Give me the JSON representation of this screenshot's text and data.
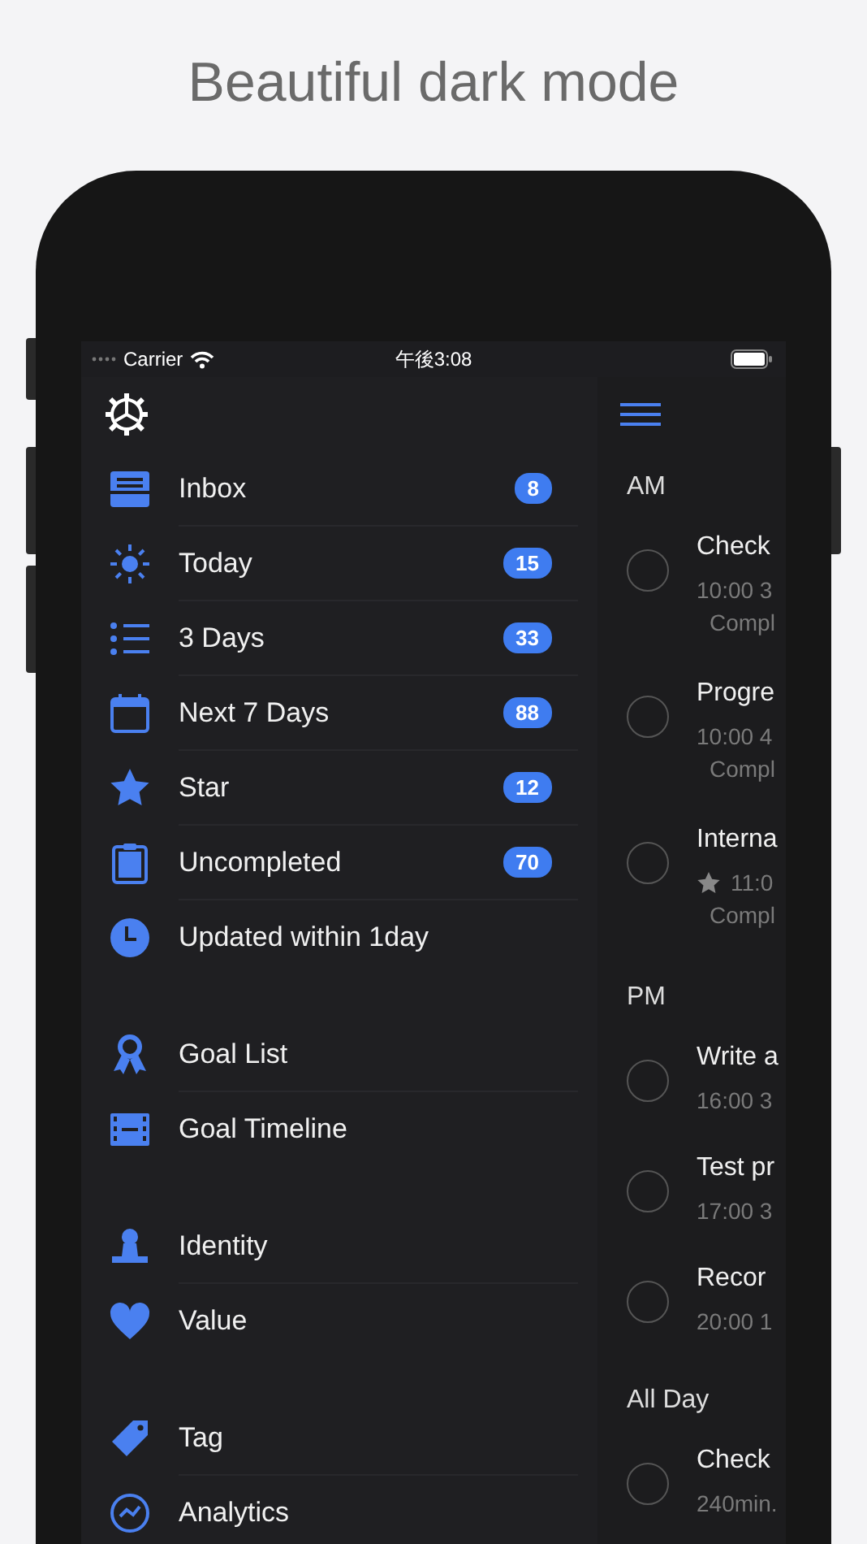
{
  "headline": "Beautiful dark mode",
  "status_bar": {
    "carrier": "Carrier",
    "time": "午後3:08"
  },
  "sidebar": {
    "sections": [
      {
        "items": [
          {
            "label": "Inbox",
            "count": "8"
          },
          {
            "label": "Today",
            "count": "15"
          },
          {
            "label": "3 Days",
            "count": "33"
          },
          {
            "label": "Next 7 Days",
            "count": "88"
          },
          {
            "label": "Star",
            "count": "12"
          },
          {
            "label": "Uncompleted",
            "count": "70"
          },
          {
            "label": "Updated within 1day"
          }
        ]
      },
      {
        "items": [
          {
            "label": "Goal List"
          },
          {
            "label": "Goal Timeline"
          }
        ]
      },
      {
        "items": [
          {
            "label": "Identity"
          },
          {
            "label": "Value"
          }
        ]
      },
      {
        "items": [
          {
            "label": "Tag"
          },
          {
            "label": "Analytics"
          }
        ]
      }
    ]
  },
  "task_list": {
    "sections": [
      {
        "header": "AM",
        "tasks": [
          {
            "title": "Check",
            "meta": "10:00 3",
            "note": "Compl",
            "starred": false,
            "checked": false
          },
          {
            "title": "Progre",
            "meta": "10:00 4",
            "note": "Compl",
            "starred": false,
            "checked": false
          },
          {
            "title": "Interna",
            "meta": "11:0",
            "note": "Compl",
            "starred": true,
            "checked": false
          }
        ]
      },
      {
        "header": "PM",
        "tasks": [
          {
            "title": "Write a",
            "meta": "16:00 3",
            "starred": false,
            "checked": false
          },
          {
            "title": "Test pr",
            "meta": "17:00 3",
            "starred": false,
            "checked": false
          },
          {
            "title": "Recor",
            "meta": "20:00 1",
            "starred": false,
            "checked": false
          }
        ]
      },
      {
        "header": "All Day",
        "tasks": [
          {
            "title": "Check",
            "meta": "240min.",
            "starred": false,
            "checked": false
          }
        ]
      }
    ]
  }
}
